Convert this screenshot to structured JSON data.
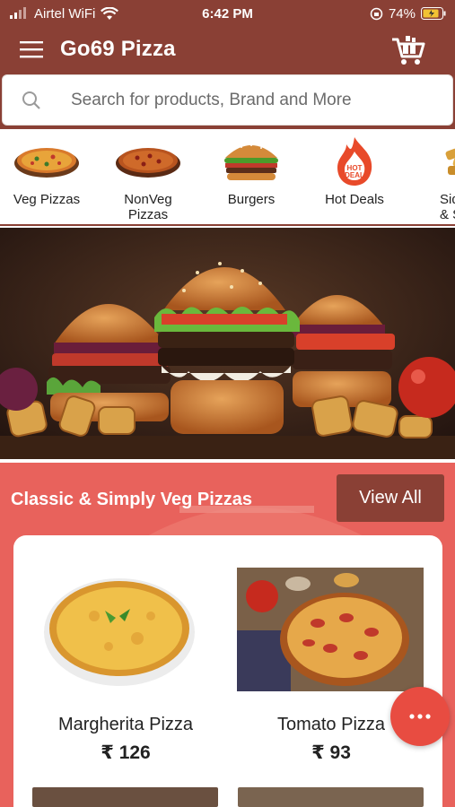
{
  "status_bar": {
    "carrier": "Airtel WiFi",
    "time": "6:42 PM",
    "battery": "74%"
  },
  "app": {
    "title": "Go69 Pizza"
  },
  "search": {
    "placeholder": "Search for products, Brand and More"
  },
  "categories": [
    {
      "label": "Veg Pizzas"
    },
    {
      "label": "NonVeg\nPizzas"
    },
    {
      "label": "Burgers"
    },
    {
      "label": "Hot Deals",
      "badge": "HOT DEAL"
    },
    {
      "label": "Sid\n& Sn"
    }
  ],
  "section": {
    "title": "Classic & Simply Veg Pizzas",
    "view_all": "View All"
  },
  "products": [
    {
      "name": "Margherita Pizza",
      "price": "₹ 126"
    },
    {
      "name": "Tomato Pizza",
      "price": "₹ 93"
    }
  ],
  "colors": {
    "brand": "#8a4035",
    "accent": "#e8625c",
    "fab": "#e84c41"
  },
  "icons": [
    "signal-icon",
    "wifi-icon",
    "hamburger-menu-icon",
    "cart-icon",
    "search-icon",
    "more-dots-icon"
  ]
}
